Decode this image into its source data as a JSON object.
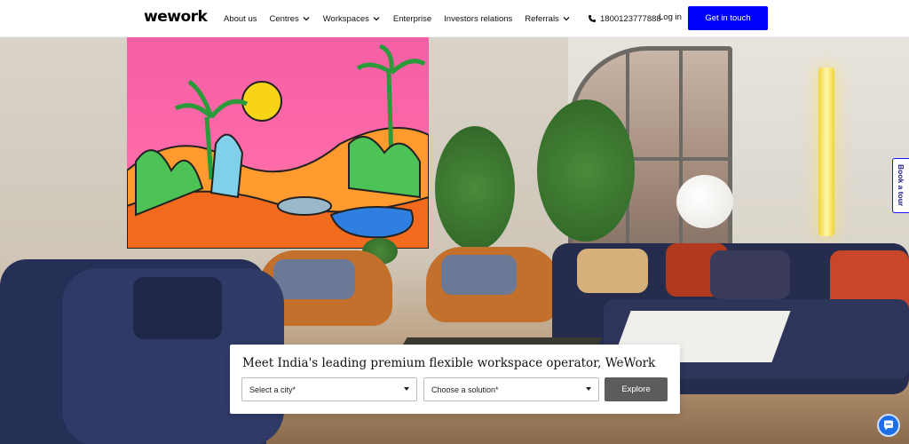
{
  "header": {
    "logo": "wework",
    "nav": [
      {
        "label": "About us",
        "dropdown": false
      },
      {
        "label": "Centres",
        "dropdown": true
      },
      {
        "label": "Workspaces",
        "dropdown": true
      },
      {
        "label": "Enterprise",
        "dropdown": false
      },
      {
        "label": "Investors relations",
        "dropdown": false
      },
      {
        "label": "Referrals",
        "dropdown": true
      }
    ],
    "phone": "1800123777888",
    "login": "Log in",
    "cta": "Get in touch"
  },
  "search": {
    "title": "Meet India's leading premium flexible workspace operator, WeWork",
    "city_placeholder": "Select a city*",
    "solution_placeholder": "Choose a solution*",
    "explore_label": "Explore"
  },
  "side_tab": {
    "label": "Book a tour"
  },
  "icons": {
    "phone": "phone-icon",
    "chevron": "chevron-down-icon",
    "chat": "chat-bubble-icon"
  },
  "colors": {
    "brand_blue": "#0000ff",
    "explore_grey": "#5c5c5c",
    "chat_blue": "#1c6fe8"
  }
}
